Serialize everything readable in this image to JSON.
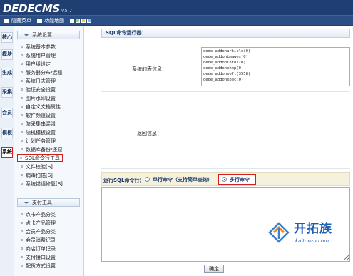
{
  "header": {
    "logo": "DEDECMS",
    "version": "v5.7",
    "links": [
      {
        "label": "隐藏菜单"
      },
      {
        "label": "功能地图"
      }
    ],
    "skins": [
      "#ffffff",
      "#9bd37c",
      "#f0c34c",
      "#7ab6ea"
    ]
  },
  "left_tabs": [
    {
      "label": "核心"
    },
    {
      "label": "模块"
    },
    {
      "label": "生成"
    },
    {
      "label": "采集"
    },
    {
      "label": "会员"
    },
    {
      "label": "模板"
    },
    {
      "label": "系统"
    }
  ],
  "sidebar": {
    "groups": [
      {
        "title": "系统设置",
        "items": [
          "系统基本参数",
          "系统用户管理",
          "用户组设定",
          "服务器分布/远程",
          "系统日志管理",
          "验证安全设置",
          "图片水印设置",
          "自定义文档属性",
          "软件频道设置",
          "防采集串混淆",
          "随机模板设置",
          "计划任务管理",
          "数据库备份/还原",
          "SQL命令行工具",
          "文件校验[S]",
          "病毒扫描[S]",
          "系统错误修复[S]"
        ]
      },
      {
        "title": "支付工具",
        "items": [
          "点卡产品分类",
          "点卡产品管理",
          "会员产品分类",
          "会员消费记录",
          "商店订单记录",
          "支付接口设置",
          "配货方式设置"
        ]
      }
    ]
  },
  "main": {
    "panel_title": "SQL命令运行器：",
    "tables_label": "系统的表信息：",
    "tables": [
      "dede_addonarticle(0)",
      "dede_addonimages(0)",
      "dede_addoninfos(0)",
      "dede_addonshop(0)",
      "dede_addonsoft(3558)",
      "dede_addonspec(0)"
    ],
    "result_label": "返回信息：",
    "run_label": "运行SQL命令行：",
    "options": [
      {
        "label": "单行命令（支持简单查询）",
        "selected": false
      },
      {
        "label": "多行命令",
        "selected": true
      }
    ],
    "sql_value": "",
    "submit_label": "确定"
  },
  "watermark": {
    "name": "开拓族",
    "url": "kaituozu.com"
  }
}
